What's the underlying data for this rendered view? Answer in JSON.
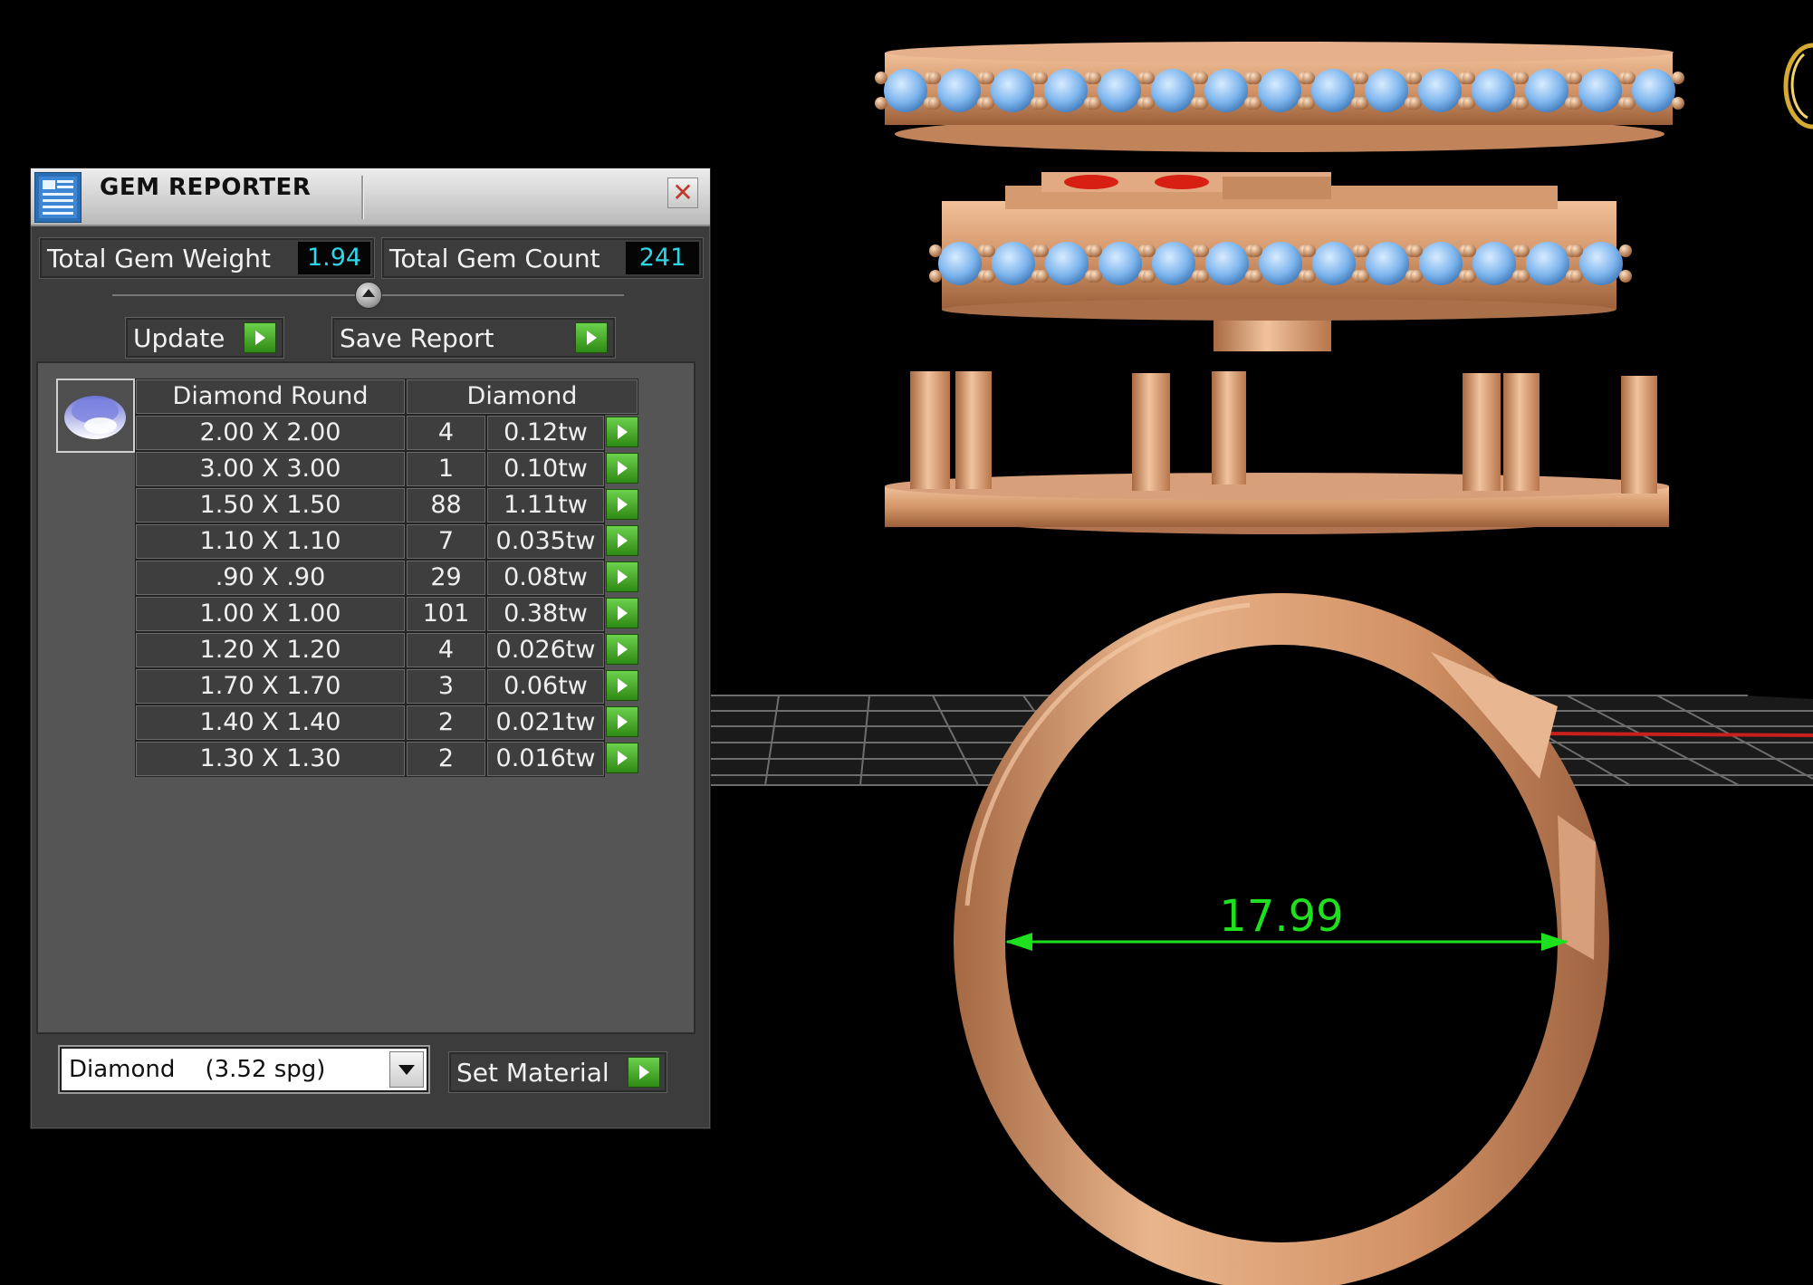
{
  "window": {
    "title": "GEM REPORTER",
    "close_icon": "close-icon"
  },
  "stats": {
    "weight_label": "Total Gem Weight",
    "weight_value": "1.94",
    "count_label": "Total Gem Count",
    "count_value": "241"
  },
  "buttons": {
    "update": "Update",
    "save_report": "Save Report",
    "set_material": "Set Material"
  },
  "gem_table": {
    "headers": [
      "Diamond Round",
      "Diamond"
    ],
    "rows": [
      {
        "size": "2.00 X 2.00",
        "count": "4",
        "weight": "0.12tw"
      },
      {
        "size": "3.00 X 3.00",
        "count": "1",
        "weight": "0.10tw"
      },
      {
        "size": "1.50 X 1.50",
        "count": "88",
        "weight": "1.11tw"
      },
      {
        "size": "1.10 X 1.10",
        "count": "7",
        "weight": "0.035tw"
      },
      {
        "size": ".90 X .90",
        "count": "29",
        "weight": "0.08tw"
      },
      {
        "size": "1.00 X 1.00",
        "count": "101",
        "weight": "0.38tw"
      },
      {
        "size": "1.20 X 1.20",
        "count": "4",
        "weight": "0.026tw"
      },
      {
        "size": "1.70 X 1.70",
        "count": "3",
        "weight": "0.06tw"
      },
      {
        "size": "1.40 X 1.40",
        "count": "2",
        "weight": "0.021tw"
      },
      {
        "size": "1.30 X 1.30",
        "count": "2",
        "weight": "0.016tw"
      }
    ]
  },
  "material": {
    "selected": "Diamond    (3.52 spg)"
  },
  "viewport": {
    "dimension_label": "17.99",
    "colors": {
      "metal": "#d79a6e",
      "gem": "#7fb6ee",
      "ruby": "#d81f14",
      "dimension": "#1ee01e",
      "value_text": "#2fd6e8"
    }
  }
}
